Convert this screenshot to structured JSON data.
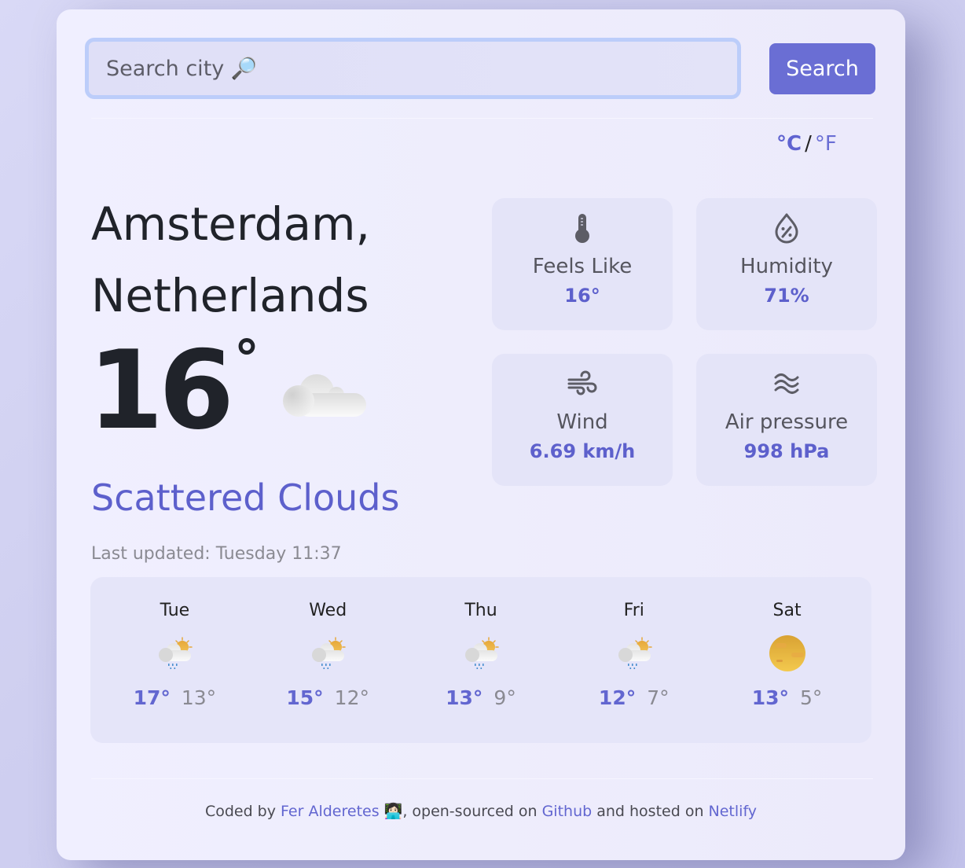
{
  "search": {
    "placeholder": "Search city 🔎",
    "value": "",
    "button_label": "Search"
  },
  "units": {
    "celsius": "°C",
    "separator": "/",
    "fahrenheit": "°F",
    "active": "celsius"
  },
  "current": {
    "city_line1": "Amsterdam,",
    "city_line2": "Netherlands",
    "temperature": "16",
    "degree_symbol": "°",
    "icon": "cloud-icon",
    "description": "Scattered Clouds",
    "last_updated": "Last updated: Tuesday 11:37"
  },
  "stats": [
    {
      "icon": "thermometer-icon",
      "label": "Feels Like",
      "value": "16°"
    },
    {
      "icon": "humidity-drop-icon",
      "label": "Humidity",
      "value": "71%"
    },
    {
      "icon": "wind-icon",
      "label": "Wind",
      "value": "6.69 km/h"
    },
    {
      "icon": "pressure-waves-icon",
      "label": "Air pressure",
      "value": "998 hPa"
    }
  ],
  "forecast": [
    {
      "day": "Tue",
      "icon": "sun-cloud-rain-icon",
      "max": "17°",
      "min": "13°"
    },
    {
      "day": "Wed",
      "icon": "sun-cloud-rain-icon",
      "max": "15°",
      "min": "12°"
    },
    {
      "day": "Thu",
      "icon": "sun-cloud-rain-icon",
      "max": "13°",
      "min": "9°"
    },
    {
      "day": "Fri",
      "icon": "sun-cloud-rain-icon",
      "max": "12°",
      "min": "7°"
    },
    {
      "day": "Sat",
      "icon": "sun-icon",
      "max": "13°",
      "min": "5°"
    }
  ],
  "footer": {
    "text1": "Coded by ",
    "author": "Fer Alderetes",
    "emoji": " 👩🏻‍💻",
    "text2": ", open-sourced on ",
    "github": "Github",
    "text3": " and hosted on ",
    "netlify": "Netlify"
  },
  "colors": {
    "accent": "#6a6ed4",
    "accent_text": "#5d60cc",
    "dark_text": "#20232a",
    "muted_text": "#8a8a92",
    "input_border": "#bccdfa"
  }
}
